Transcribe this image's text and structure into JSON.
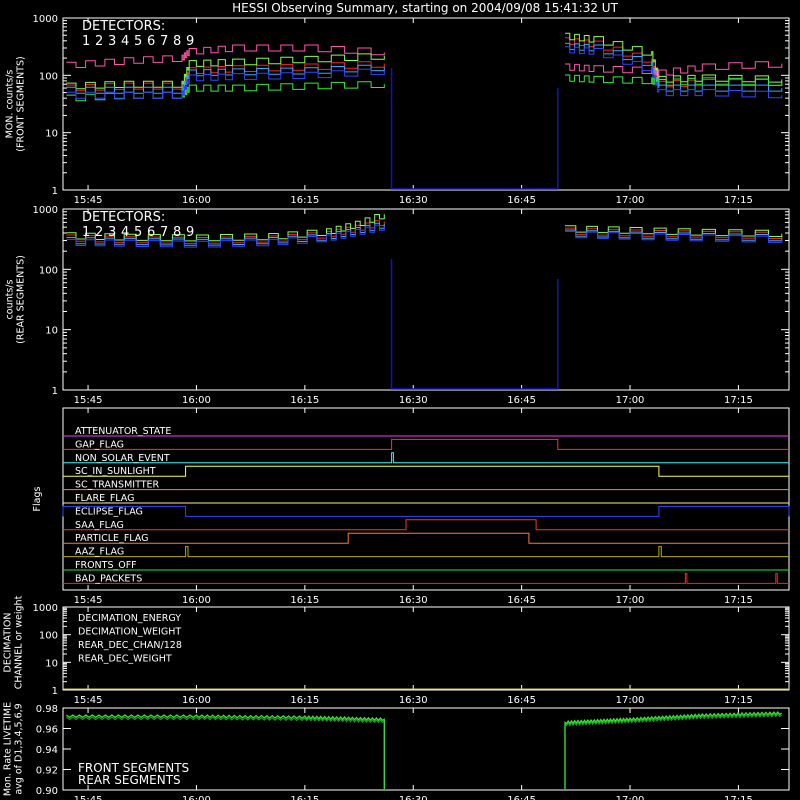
{
  "title": "HESSI Observing Summary, starting on 2004/09/08 15:41:32 UT",
  "time_axis": {
    "start": "15:41:32",
    "end": "17:22:00",
    "tick_labels": [
      "15:45",
      "16:00",
      "16:15",
      "16:30",
      "16:45",
      "17:00",
      "17:15"
    ]
  },
  "detectors": {
    "label": "DETECTORS:",
    "numbers": [
      "1",
      "2",
      "3",
      "4",
      "5",
      "6",
      "7",
      "8",
      "9"
    ],
    "colors": [
      "#ff2020",
      "#ff55aa",
      "#ff9900",
      "#ffff33",
      "#88ff44",
      "#33ee33",
      "#22ffaa",
      "#33aaff",
      "#3344ff"
    ]
  },
  "colors": {
    "background": "#000000",
    "axes": "#ffffff",
    "gap_fill": "#1010d0"
  },
  "chart_data": [
    {
      "panel": "front",
      "type": "line",
      "ylabel": [
        "MON. counts/s",
        "(FRONT SEGMENTS)"
      ],
      "yscale": "log",
      "ylim": [
        1,
        1000
      ],
      "ytick_labels": [
        "1",
        "10",
        "100",
        "1000"
      ],
      "data_gaps": [
        [
          "16:27:00",
          "16:50:00"
        ]
      ],
      "x": [
        "15:42",
        "15:50",
        "15:58",
        "15:59",
        "16:05",
        "16:15",
        "16:26",
        "16:51",
        "16:55",
        "17:03",
        "17:04",
        "17:10",
        "17:21"
      ],
      "series": [
        {
          "name": "1",
          "values": [
            60,
            65,
            65,
            120,
            130,
            140,
            160,
            400,
            350,
            170,
            70,
            75,
            75
          ]
        },
        {
          "name": "2",
          "values": [
            150,
            180,
            200,
            260,
            300,
            300,
            250,
            140,
            130,
            120,
            110,
            140,
            160
          ]
        },
        {
          "name": "5",
          "values": [
            65,
            70,
            70,
            160,
            170,
            190,
            220,
            480,
            420,
            230,
            85,
            90,
            85
          ]
        },
        {
          "name": "6",
          "values": [
            40,
            45,
            45,
            60,
            60,
            65,
            70,
            90,
            85,
            80,
            75,
            80,
            75
          ]
        },
        {
          "name": "8",
          "values": [
            55,
            55,
            55,
            110,
            115,
            120,
            140,
            320,
            300,
            150,
            60,
            60,
            60
          ]
        },
        {
          "name": "9",
          "values": [
            45,
            45,
            45,
            90,
            95,
            100,
            120,
            280,
            260,
            120,
            50,
            50,
            45
          ]
        }
      ]
    },
    {
      "panel": "rear",
      "type": "line",
      "ylabel": [
        "counts/s",
        "(REAR SEGMENTS)"
      ],
      "yscale": "log",
      "ylim": [
        1,
        1000
      ],
      "ytick_labels": [
        "1",
        "10",
        "100",
        "1000"
      ],
      "data_gaps": [
        [
          "16:27:00",
          "16:50:00"
        ]
      ],
      "x": [
        "15:42",
        "15:50",
        "16:00",
        "16:10",
        "16:18",
        "16:22",
        "16:26",
        "16:51",
        "17:00",
        "17:10",
        "17:21"
      ],
      "series": [
        {
          "name": "1",
          "values": [
            330,
            310,
            300,
            320,
            380,
            480,
            620,
            430,
            400,
            380,
            360
          ]
        },
        {
          "name": "5",
          "values": [
            360,
            340,
            330,
            350,
            420,
            560,
            820,
            470,
            440,
            410,
            390
          ]
        },
        {
          "name": "8",
          "values": [
            300,
            290,
            280,
            300,
            350,
            440,
            560,
            400,
            370,
            350,
            330
          ]
        },
        {
          "name": "9",
          "values": [
            280,
            270,
            260,
            280,
            330,
            410,
            520,
            380,
            350,
            330,
            310
          ]
        }
      ]
    },
    {
      "panel": "flags",
      "type": "line",
      "ylabel": "Flags",
      "flags": [
        {
          "name": "ATTENUATOR_STATE",
          "color": "#ff33ff",
          "on": []
        },
        {
          "name": "GAP_FLAG",
          "color": "#ff3030",
          "on": [
            [
              "16:27:00",
              "16:50:00"
            ]
          ]
        },
        {
          "name": "NON_SOLAR_EVENT",
          "color": "#22ffff",
          "on": [
            [
              "16:27:00",
              "16:27:15"
            ]
          ]
        },
        {
          "name": "SC_IN_SUNLIGHT",
          "color": "#ffff44",
          "on": [
            [
              "15:58:30",
              "17:04:00"
            ]
          ]
        },
        {
          "name": "SC_TRANSMITTER",
          "color": "#ff7f50",
          "on": []
        },
        {
          "name": "FLARE_FLAG",
          "color": "#ffee88",
          "on": []
        },
        {
          "name": "ECLIPSE_FLAG",
          "color": "#3344ff",
          "on": [
            [
              "15:41:32",
              "15:58:30"
            ],
            [
              "17:04:00",
              "17:22:00"
            ]
          ]
        },
        {
          "name": "SAA_FLAG",
          "color": "#ff3030",
          "on": [
            [
              "16:29:00",
              "16:47:00"
            ]
          ]
        },
        {
          "name": "PARTICLE_FLAG",
          "color": "#ff7733",
          "on": [
            [
              "16:21:00",
              "16:46:00"
            ]
          ]
        },
        {
          "name": "AAZ_FLAG",
          "color": "#bbaa00",
          "on": [
            [
              "15:58:30",
              "15:58:50"
            ],
            [
              "17:04:00",
              "17:04:20"
            ]
          ]
        },
        {
          "name": "FRONTS_OFF",
          "color": "#22ee22",
          "on": []
        },
        {
          "name": "BAD_PACKETS",
          "color": "#ff2020",
          "on": [
            [
              "17:07:40",
              "17:07:50"
            ],
            [
              "17:20:10",
              "17:20:20"
            ]
          ]
        }
      ]
    },
    {
      "panel": "decimation",
      "type": "line",
      "ylabel": [
        "DECIMATION",
        "CHANNEL or weight"
      ],
      "yscale": "log",
      "ylim": [
        1,
        1000
      ],
      "ytick_labels": [
        "1",
        "10",
        "100",
        "1000"
      ],
      "legend": [
        {
          "name": "DECIMATION_ENERGY",
          "color": "#33ff33"
        },
        {
          "name": "DECIMATION_WEIGHT",
          "color": "#ff7f50"
        },
        {
          "name": "REAR_DEC_CHAN/128",
          "color": "#22ffff"
        },
        {
          "name": "REAR_DEC_WEIGHT",
          "color": "#ccbb66"
        }
      ]
    },
    {
      "panel": "livetime",
      "type": "line",
      "ylabel": [
        "Mon. Rate LIVETIME",
        "avg of D1,3,4,5,6,9"
      ],
      "ylim": [
        0.9,
        0.98
      ],
      "ytick_labels": [
        "0.90",
        "0.92",
        "0.94",
        "0.96",
        "0.98"
      ],
      "data_gaps": [
        [
          "16:27:00",
          "16:50:00"
        ]
      ],
      "legend": [
        {
          "name": "FRONT SEGMENTS",
          "color": "#33ee33"
        },
        {
          "name": "REAR SEGMENTS",
          "color": "#229922"
        }
      ],
      "x": [
        "15:42",
        "16:00",
        "16:15",
        "16:26",
        "16:51",
        "17:00",
        "17:10",
        "17:21"
      ],
      "series": [
        {
          "name": "FRONT SEGMENTS",
          "values": [
            0.972,
            0.972,
            0.971,
            0.969,
            0.966,
            0.969,
            0.973,
            0.975
          ]
        },
        {
          "name": "REAR SEGMENTS",
          "values": [
            0.97,
            0.97,
            0.969,
            0.967,
            0.964,
            0.967,
            0.971,
            0.973
          ]
        }
      ]
    }
  ]
}
